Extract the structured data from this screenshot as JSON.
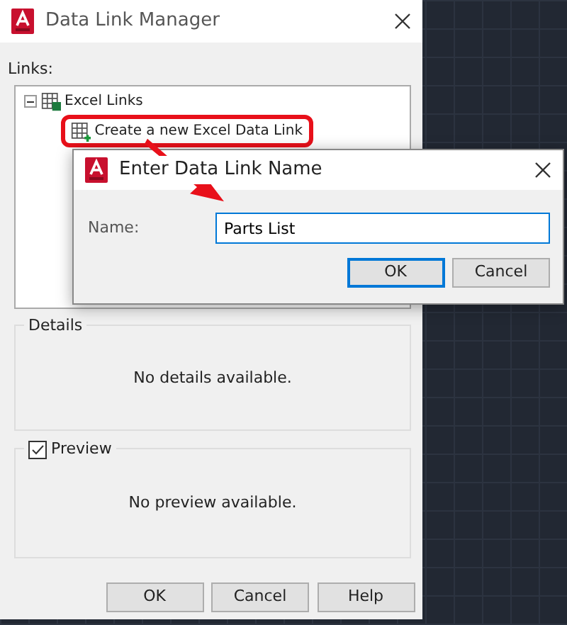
{
  "window": {
    "title": "Data Link Manager"
  },
  "links": {
    "label": "Links:",
    "tree": [
      {
        "label": "Excel Links",
        "expanded": true,
        "children": [
          {
            "label": "Create a new Excel Data Link"
          }
        ]
      }
    ]
  },
  "details": {
    "title": "Details",
    "message": "No details available."
  },
  "preview": {
    "title": "Preview",
    "checked": true,
    "message": "No preview available."
  },
  "buttons": [
    {
      "label": "OK",
      "default": false
    },
    {
      "label": "Cancel",
      "default": false
    },
    {
      "label": "Help",
      "default": false
    }
  ],
  "dialog": {
    "title": "Enter Data Link Name",
    "name_label": "Name:",
    "name_value": "Parts List",
    "buttons": [
      {
        "label": "OK",
        "default": true
      },
      {
        "label": "Cancel",
        "default": false
      }
    ]
  }
}
